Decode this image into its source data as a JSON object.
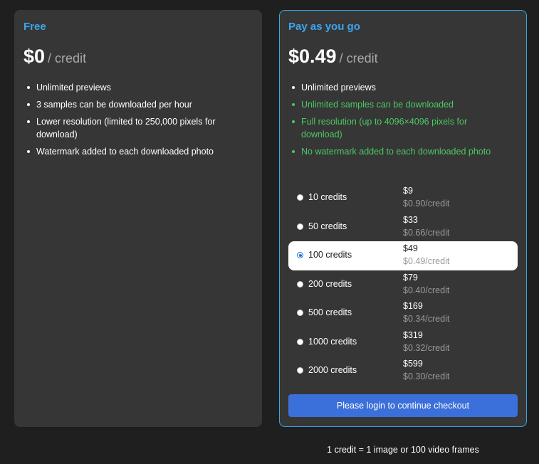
{
  "free": {
    "title": "Free",
    "price": "$0",
    "unit": "/ credit",
    "features": [
      "Unlimited previews",
      "3 samples can be downloaded per hour",
      "Lower resolution (limited to 250,000 pixels for download)",
      "Watermark added to each downloaded photo"
    ]
  },
  "payg": {
    "title": "Pay as you go",
    "price": "$0.49",
    "unit": "/ credit",
    "features": [
      "Unlimited previews",
      "Unlimited samples can be downloaded",
      "Full resolution (up to 4096×4096 pixels for download)",
      "No watermark added to each downloaded photo"
    ],
    "options": [
      {
        "label": "10 credits",
        "price": "$9",
        "per": "$0.90/credit"
      },
      {
        "label": "50 credits",
        "price": "$33",
        "per": "$0.66/credit"
      },
      {
        "label": "100 credits",
        "price": "$49",
        "per": "$0.49/credit"
      },
      {
        "label": "200 credits",
        "price": "$79",
        "per": "$0.40/credit"
      },
      {
        "label": "500 credits",
        "price": "$169",
        "per": "$0.34/credit"
      },
      {
        "label": "1000 credits",
        "price": "$319",
        "per": "$0.32/credit"
      },
      {
        "label": "2000 credits",
        "price": "$599",
        "per": "$0.30/credit"
      }
    ],
    "selected_option": "100 credits",
    "checkout_label": "Please login to continue checkout"
  },
  "footnote": "1 credit = 1 image or 100 video frames",
  "colors": {
    "accent_blue": "#3aa6f0",
    "feature_green": "#4cc763",
    "button_blue": "#3b6fd9",
    "card_bg": "#363636",
    "page_bg": "#1f1f1f"
  }
}
